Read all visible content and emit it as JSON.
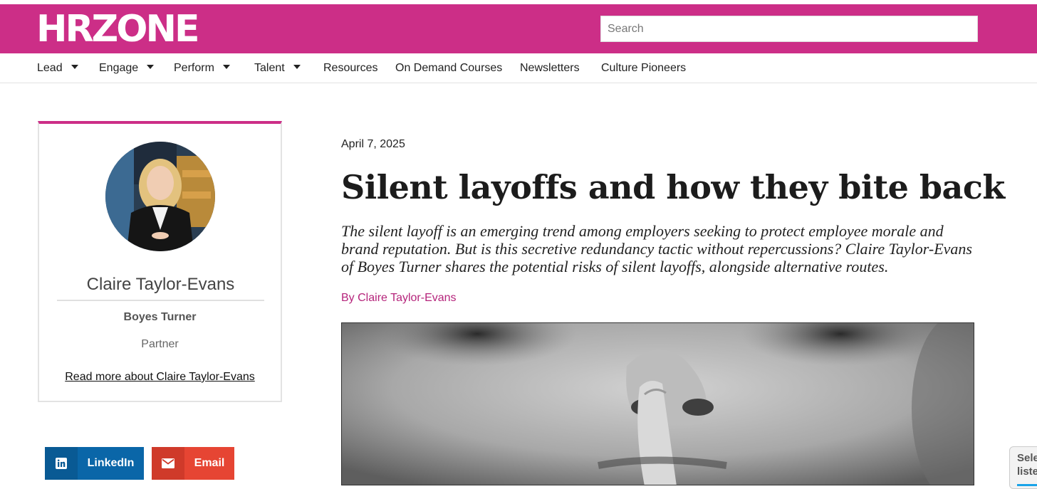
{
  "header": {
    "logo": "HRZONE",
    "search_placeholder": "Search"
  },
  "nav": [
    {
      "label": "Lead",
      "has_dropdown": true
    },
    {
      "label": "Engage",
      "has_dropdown": true
    },
    {
      "label": "Perform",
      "has_dropdown": true
    },
    {
      "label": "Talent",
      "has_dropdown": true
    },
    {
      "label": "Resources",
      "has_dropdown": false
    },
    {
      "label": "On Demand Courses",
      "has_dropdown": false
    },
    {
      "label": "Newsletters",
      "has_dropdown": false
    },
    {
      "label": "Culture Pioneers",
      "has_dropdown": false
    }
  ],
  "author": {
    "name": "Claire Taylor-Evans",
    "company": "Boyes Turner",
    "role": "Partner",
    "read_more": "Read more about Claire Taylor-Evans"
  },
  "share": {
    "linkedin_label": "LinkedIn",
    "email_label": "Email"
  },
  "article": {
    "date": "April 7, 2025",
    "title": "Silent layoffs and how they bite back",
    "standfirst": "The silent layoff is an emerging trend among employers seeking to protect employee morale and brand reputation. But is this secretive redundancy tactic without repercussions? Claire Taylor-Evans of Boyes Turner shares the potential risks of silent layoffs, alongside alternative routes.",
    "byline_prefix": "By ",
    "byline_author": "Claire Taylor-Evans"
  },
  "widget": {
    "line1": "Sele",
    "line2": "liste"
  },
  "colors": {
    "brand": "#cc2e87",
    "linkedin": "#0a66a8",
    "email": "#e64533"
  }
}
